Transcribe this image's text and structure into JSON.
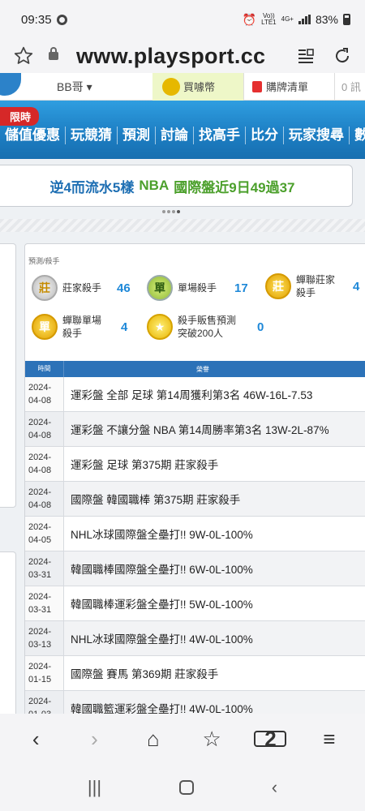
{
  "status": {
    "time": "09:35",
    "volte": "Vo))",
    "lte": "LTE1",
    "net": "4G+",
    "battery": "83%"
  },
  "browser": {
    "url": "www.playsport.cc",
    "tab_count": "2"
  },
  "topstrip": {
    "dropdown": "BB哥 ▾",
    "coin_tab": "買噱幣",
    "cart_tab": "購牌清單",
    "more_tab": "0 訊"
  },
  "nav": {
    "promo": "限時",
    "items": [
      "儲值優惠",
      "玩競猜",
      "預測",
      "討論",
      "找高手",
      "比分",
      "玩家搜尋",
      "數"
    ]
  },
  "banner": {
    "main": "逆4而流水5樣",
    "nba": "NBA",
    "rest": "國際盤近9日49過37"
  },
  "panel": {
    "breadcrumb": "預測/殺手",
    "medals": [
      {
        "icon": "莊",
        "label": "莊家殺手",
        "count": "46"
      },
      {
        "icon": "單",
        "label": "單場殺手",
        "count": "17"
      },
      {
        "icon": "莊",
        "label_l1": "蟬聯莊家",
        "label_l2": "殺手",
        "count": "4"
      },
      {
        "icon": "單",
        "label_l1": "蟬聯單場",
        "label_l2": "殺手",
        "count": "4"
      },
      {
        "icon": "★",
        "label_l1": "殺手販售預測",
        "label_l2": "突破200人",
        "count": "0"
      }
    ],
    "table": {
      "col_time": "時間",
      "col_honor": "榮譽",
      "rows": [
        {
          "y": "2024-",
          "md": "04-08",
          "text": "運彩盤 全部 足球 第14周獲利第3名 46W-16L-7.53"
        },
        {
          "y": "2024-",
          "md": "04-08",
          "text": "運彩盤 不讓分盤 NBA 第14周勝率第3名 13W-2L-87%"
        },
        {
          "y": "2024-",
          "md": "04-08",
          "text": "運彩盤 足球 第375期 莊家殺手"
        },
        {
          "y": "2024-",
          "md": "04-08",
          "text": "國際盤 韓國職棒 第375期 莊家殺手"
        },
        {
          "y": "2024-",
          "md": "04-05",
          "text": "NHL冰球國際盤全壘打!! 9W-0L-100%"
        },
        {
          "y": "2024-",
          "md": "03-31",
          "text": "韓國職棒國際盤全壘打!! 6W-0L-100%"
        },
        {
          "y": "2024-",
          "md": "03-31",
          "text": "韓國職棒運彩盤全壘打!! 5W-0L-100%"
        },
        {
          "y": "2024-",
          "md": "03-13",
          "text": "NHL冰球國際盤全壘打!! 4W-0L-100%"
        },
        {
          "y": "2024-",
          "md": "01-15",
          "text": "國際盤 賽馬 第369期 莊家殺手"
        },
        {
          "y": "2024-",
          "md": "01-03",
          "text": "韓國職籃運彩盤全壘打!! 4W-0L-100%"
        }
      ]
    }
  },
  "bottom_nav": {
    "back": "‹",
    "forward": "›",
    "home": "⌂",
    "bookmark": "☆",
    "menu": "≡"
  },
  "system_nav": {
    "recents": "|||",
    "back": "‹"
  },
  "colors": {
    "nav_blue": "#1d7fc4",
    "table_header": "#2c72b8",
    "count_blue": "#1e88d8",
    "banner_text": "#1e6fb3",
    "banner_green": "#4ca02c",
    "promo_red": "#d62828"
  }
}
